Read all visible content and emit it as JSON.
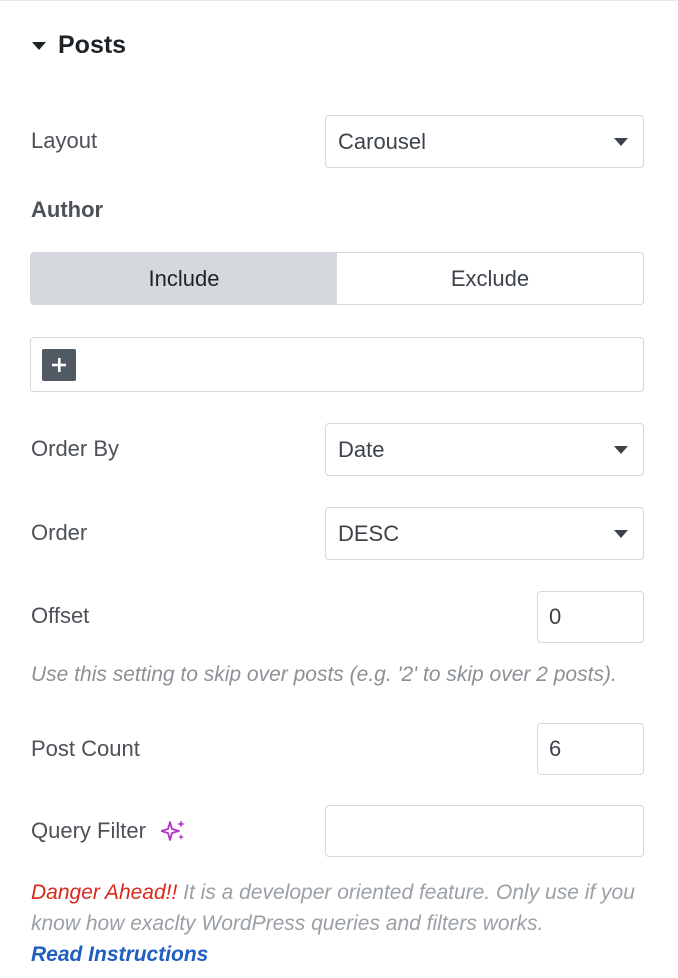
{
  "section": {
    "title": "Posts"
  },
  "layout": {
    "label": "Layout",
    "value": "Carousel"
  },
  "author": {
    "label": "Author",
    "include_label": "Include",
    "exclude_label": "Exclude",
    "selected": "Include"
  },
  "order_by": {
    "label": "Order By",
    "value": "Date"
  },
  "order": {
    "label": "Order",
    "value": "DESC"
  },
  "offset": {
    "label": "Offset",
    "value": "0",
    "help": "Use this setting to skip over posts (e.g. '2' to skip over 2 posts)."
  },
  "post_count": {
    "label": "Post Count",
    "value": "6"
  },
  "query_filter": {
    "label": "Query Filter",
    "value": "",
    "icon": "ai-sparkle-icon",
    "icon_color": "#b233c7"
  },
  "warning": {
    "danger_text": "Danger Ahead!!",
    "text": " It is a developer oriented feature. Only use if you know how exaclty WordPress queries and filters works.",
    "link_text": "Read Instructions"
  },
  "colors": {
    "danger": "#d8271b",
    "link": "#1f5fbf",
    "active_segment": "#d5d8dc"
  }
}
